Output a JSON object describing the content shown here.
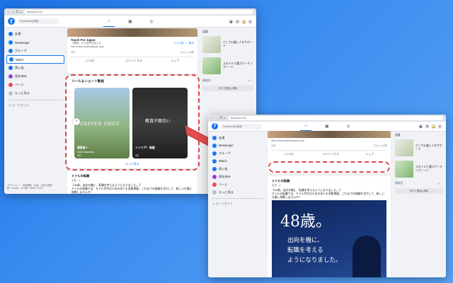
{
  "browser": {
    "url": "facebook.com",
    "nav_icons": "← → C ⌂"
  },
  "fb": {
    "search_placeholder": "Facebookを検索",
    "logo_letter": "f",
    "tabs": [
      "⌂",
      "▣",
      "◎"
    ],
    "header_icons": [
      "▦",
      "✉",
      "🔔",
      "▾"
    ]
  },
  "sidebar": {
    "items": [
      {
        "label": "友達",
        "color": "#1877f2"
      },
      {
        "label": "Messenger",
        "color": "#0a7cff"
      },
      {
        "label": "グループ",
        "color": "#1877f2"
      },
      {
        "label": "Watch",
        "color": "#1877f2"
      },
      {
        "label": "思い出",
        "color": "#1877f2"
      },
      {
        "label": "保存済み",
        "color": "#8e45d6"
      },
      {
        "label": "ページ",
        "color": "#f3425f"
      },
      {
        "label": "もっと見る",
        "color": "#65676b"
      }
    ],
    "shortcuts": "ショートカット",
    "footer": "プライバシー・利用規約・広告・広告の選択肢・Cookie・その他・Meta © 2022"
  },
  "post1": {
    "page_name": "Teach For Japan",
    "desc": "「教室」から世界を変える",
    "link": "http://www.teachforjapan.org/",
    "like_page": "「いいね！」済み",
    "likes_count": "123",
    "comments_count": "コメント4件",
    "like": "いいね！",
    "comment": "コメントする",
    "share": "シェア"
  },
  "reels": {
    "title": "リール＆ショート動画",
    "more": "もっと見る",
    "clips": [
      {
        "overlay": "DRIVER SHOT",
        "caption": "賞賛者人",
        "author": "Keito Sakamoto",
        "views": "4万"
      },
      {
        "overlay": "教育が面白い",
        "caption": "インドア？ 結婚",
        "author": "",
        "views": "4万"
      }
    ]
  },
  "post2": {
    "page_name": "ミドルの転職",
    "time": "広告 · ◎",
    "body": "【40歳。出向を機に、転職を考えるようになりました。】",
    "body2": "ミドルの転職では、ミドル世代のための求人を多数掲載。これまでの経験を活かして、新しい仕事に挑戦しませんか？",
    "ad_big": "48歳。",
    "ad_lines": [
      "出向を機に、",
      "転職を考える",
      "ようになりました。"
    ]
  },
  "right": {
    "ads_title": "広告",
    "ads": [
      {
        "text": "どこでも働く人をサポート"
      },
      {
        "text": "スタイルで選ぶゲーミングノート"
      }
    ],
    "contacts": "連絡先",
    "see_all": "すべて見る (3件)"
  }
}
